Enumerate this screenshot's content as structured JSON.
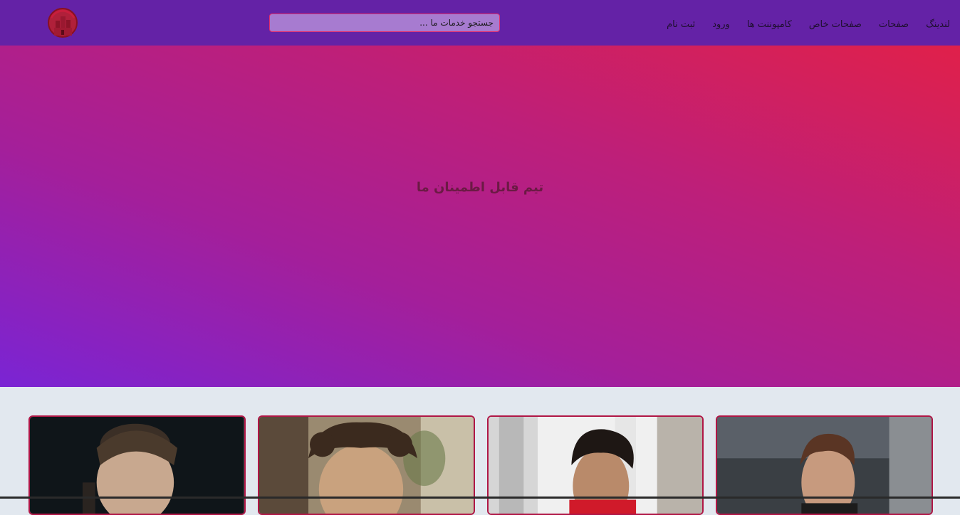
{
  "nav": {
    "items": [
      {
        "label": "لندینگ"
      },
      {
        "label": "صفحات"
      },
      {
        "label": "صفحات خاص"
      },
      {
        "label": "کامپوننت ها"
      },
      {
        "label": "ورود"
      },
      {
        "label": "ثبت نام"
      }
    ],
    "search_placeholder": "جستجو خدمات ما ...",
    "logo_icon": "castle-logo-icon"
  },
  "hero": {
    "title": "تیم قابل اطمینان ما"
  },
  "team_cards": [
    {
      "photo": "man-dark-background-photo"
    },
    {
      "photo": "man-curly-hair-photo"
    },
    {
      "photo": "man-white-building-photo"
    },
    {
      "photo": "man-street-photo"
    }
  ],
  "colors": {
    "navbar": "#6422a6",
    "accent": "#b01646",
    "hero_gradient": [
      "#7a24d4",
      "#e0204a"
    ]
  }
}
